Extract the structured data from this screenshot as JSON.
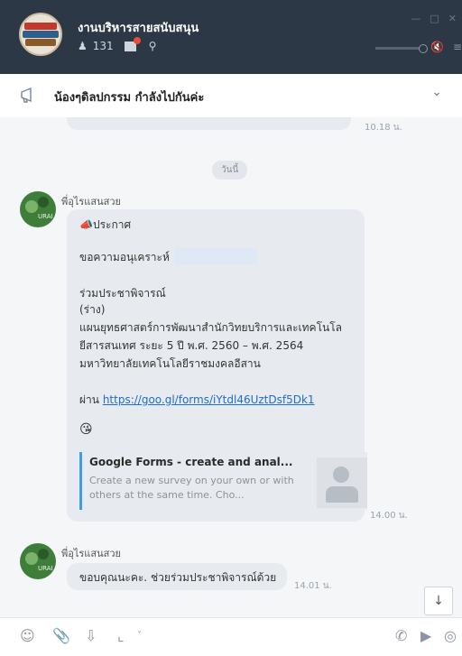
{
  "header": {
    "group_name": "งานบริหารสายสนับสนุน",
    "member_count": "131",
    "search_icon": "search-icon"
  },
  "announcement": {
    "text": "น้องๆดิลปกรรม กำลังไปกันค่ะ"
  },
  "chat": {
    "previous_time": "10.18 น.",
    "day_label": "วันนี้",
    "message1": {
      "sender": "พี่อุไรแสนสวย",
      "lines": [
        "ประกาศ",
        "ขอความอนุเคราะห์",
        "",
        "ร่วมประชาพิจารณ์",
        "(ร่าง)",
        "แผนยุทธศาสตร์การพัฒนาสำนักวิทยบริการและเทคโนโล",
        "ยีสารสนเทศ ระยะ 5 ปี พ.ศ. 2560 – พ.ศ. 2564",
        "มหาวิทยาลัยเทคโนโลยีราชมงคลอีสาน"
      ],
      "via_label": "ผ่าน",
      "link": "https://goo.gl/forms/iYtdl46UztDsf5Dk1",
      "emoji": "😘",
      "preview_title": "Google Forms - create and anal...",
      "preview_desc": "Create a new survey on your own or with others at the same time. Cho...",
      "time": "14.00 น."
    },
    "message2": {
      "sender": "พี่อุไรแสนสวย",
      "text": "ขอบคุณนะคะ. ช่วยร่วมประชาพิจารณ์ด้วย",
      "time": "14.01 น."
    },
    "avatar_text": "URAI"
  }
}
